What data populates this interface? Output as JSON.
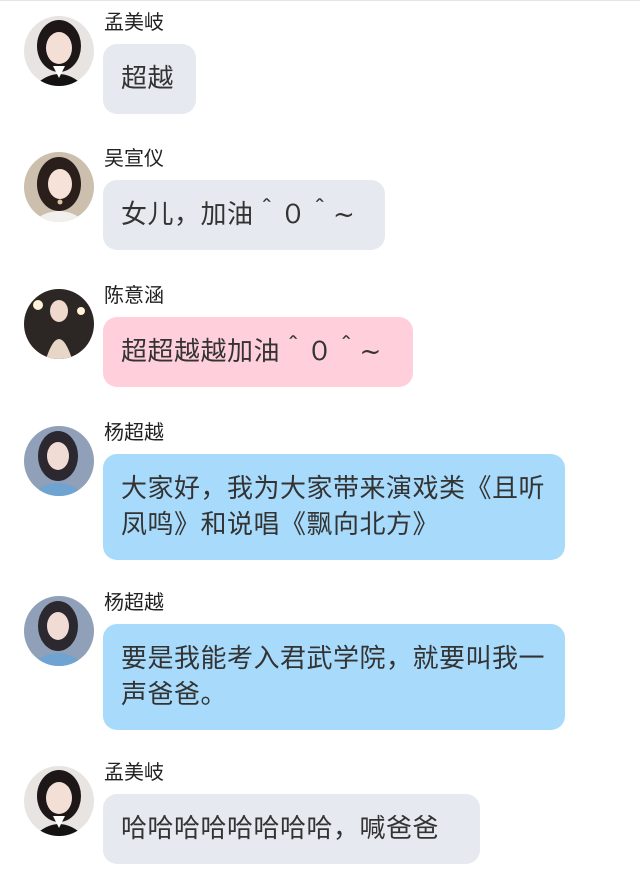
{
  "messages": [
    {
      "sender": "孟美岐",
      "text": "超越",
      "bubble_color": "#e6e9ef"
    },
    {
      "sender": "吴宣仪",
      "text": "女儿，加油＾０＾~",
      "bubble_color": "#e6e9ef"
    },
    {
      "sender": "陈意涵",
      "text": "超超越越加油＾０＾~",
      "bubble_color": "#ffd0dc"
    },
    {
      "sender": "杨超越",
      "text": "大家好，我为大家带来演戏类《且听凤鸣》和说唱《飘向北方》",
      "bubble_color": "#a8dbfb"
    },
    {
      "sender": "杨超越",
      "text": "要是我能考入君武学院，就要叫我一声爸爸。",
      "bubble_color": "#a8dbfb"
    },
    {
      "sender": "孟美岐",
      "text": "哈哈哈哈哈哈哈哈，喊爸爸",
      "bubble_color": "#e6e9ef"
    }
  ]
}
